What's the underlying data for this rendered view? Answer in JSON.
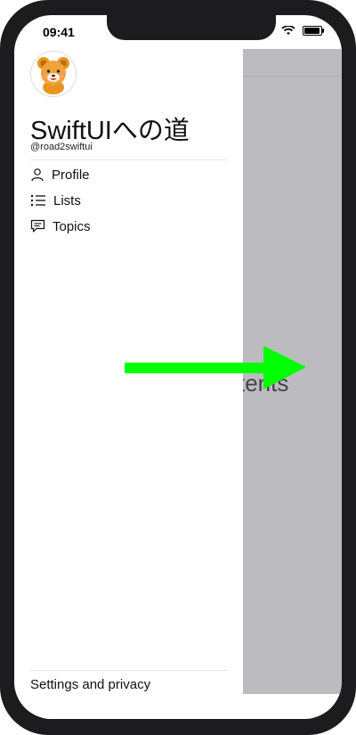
{
  "status_bar": {
    "time": "09:41"
  },
  "drawer": {
    "title": "SwiftUIへの道",
    "handle": "@road2swiftui",
    "menu": [
      {
        "label": "Profile",
        "icon": "person-icon"
      },
      {
        "label": "Lists",
        "icon": "list-icon"
      },
      {
        "label": "Topics",
        "icon": "chat-bubble-icon"
      }
    ],
    "footer_link": "Settings and privacy"
  },
  "main": {
    "partial_text": "tents"
  },
  "overlay": {
    "arrow_color": "#00ff00",
    "dim_color": "#bcbcc0"
  }
}
